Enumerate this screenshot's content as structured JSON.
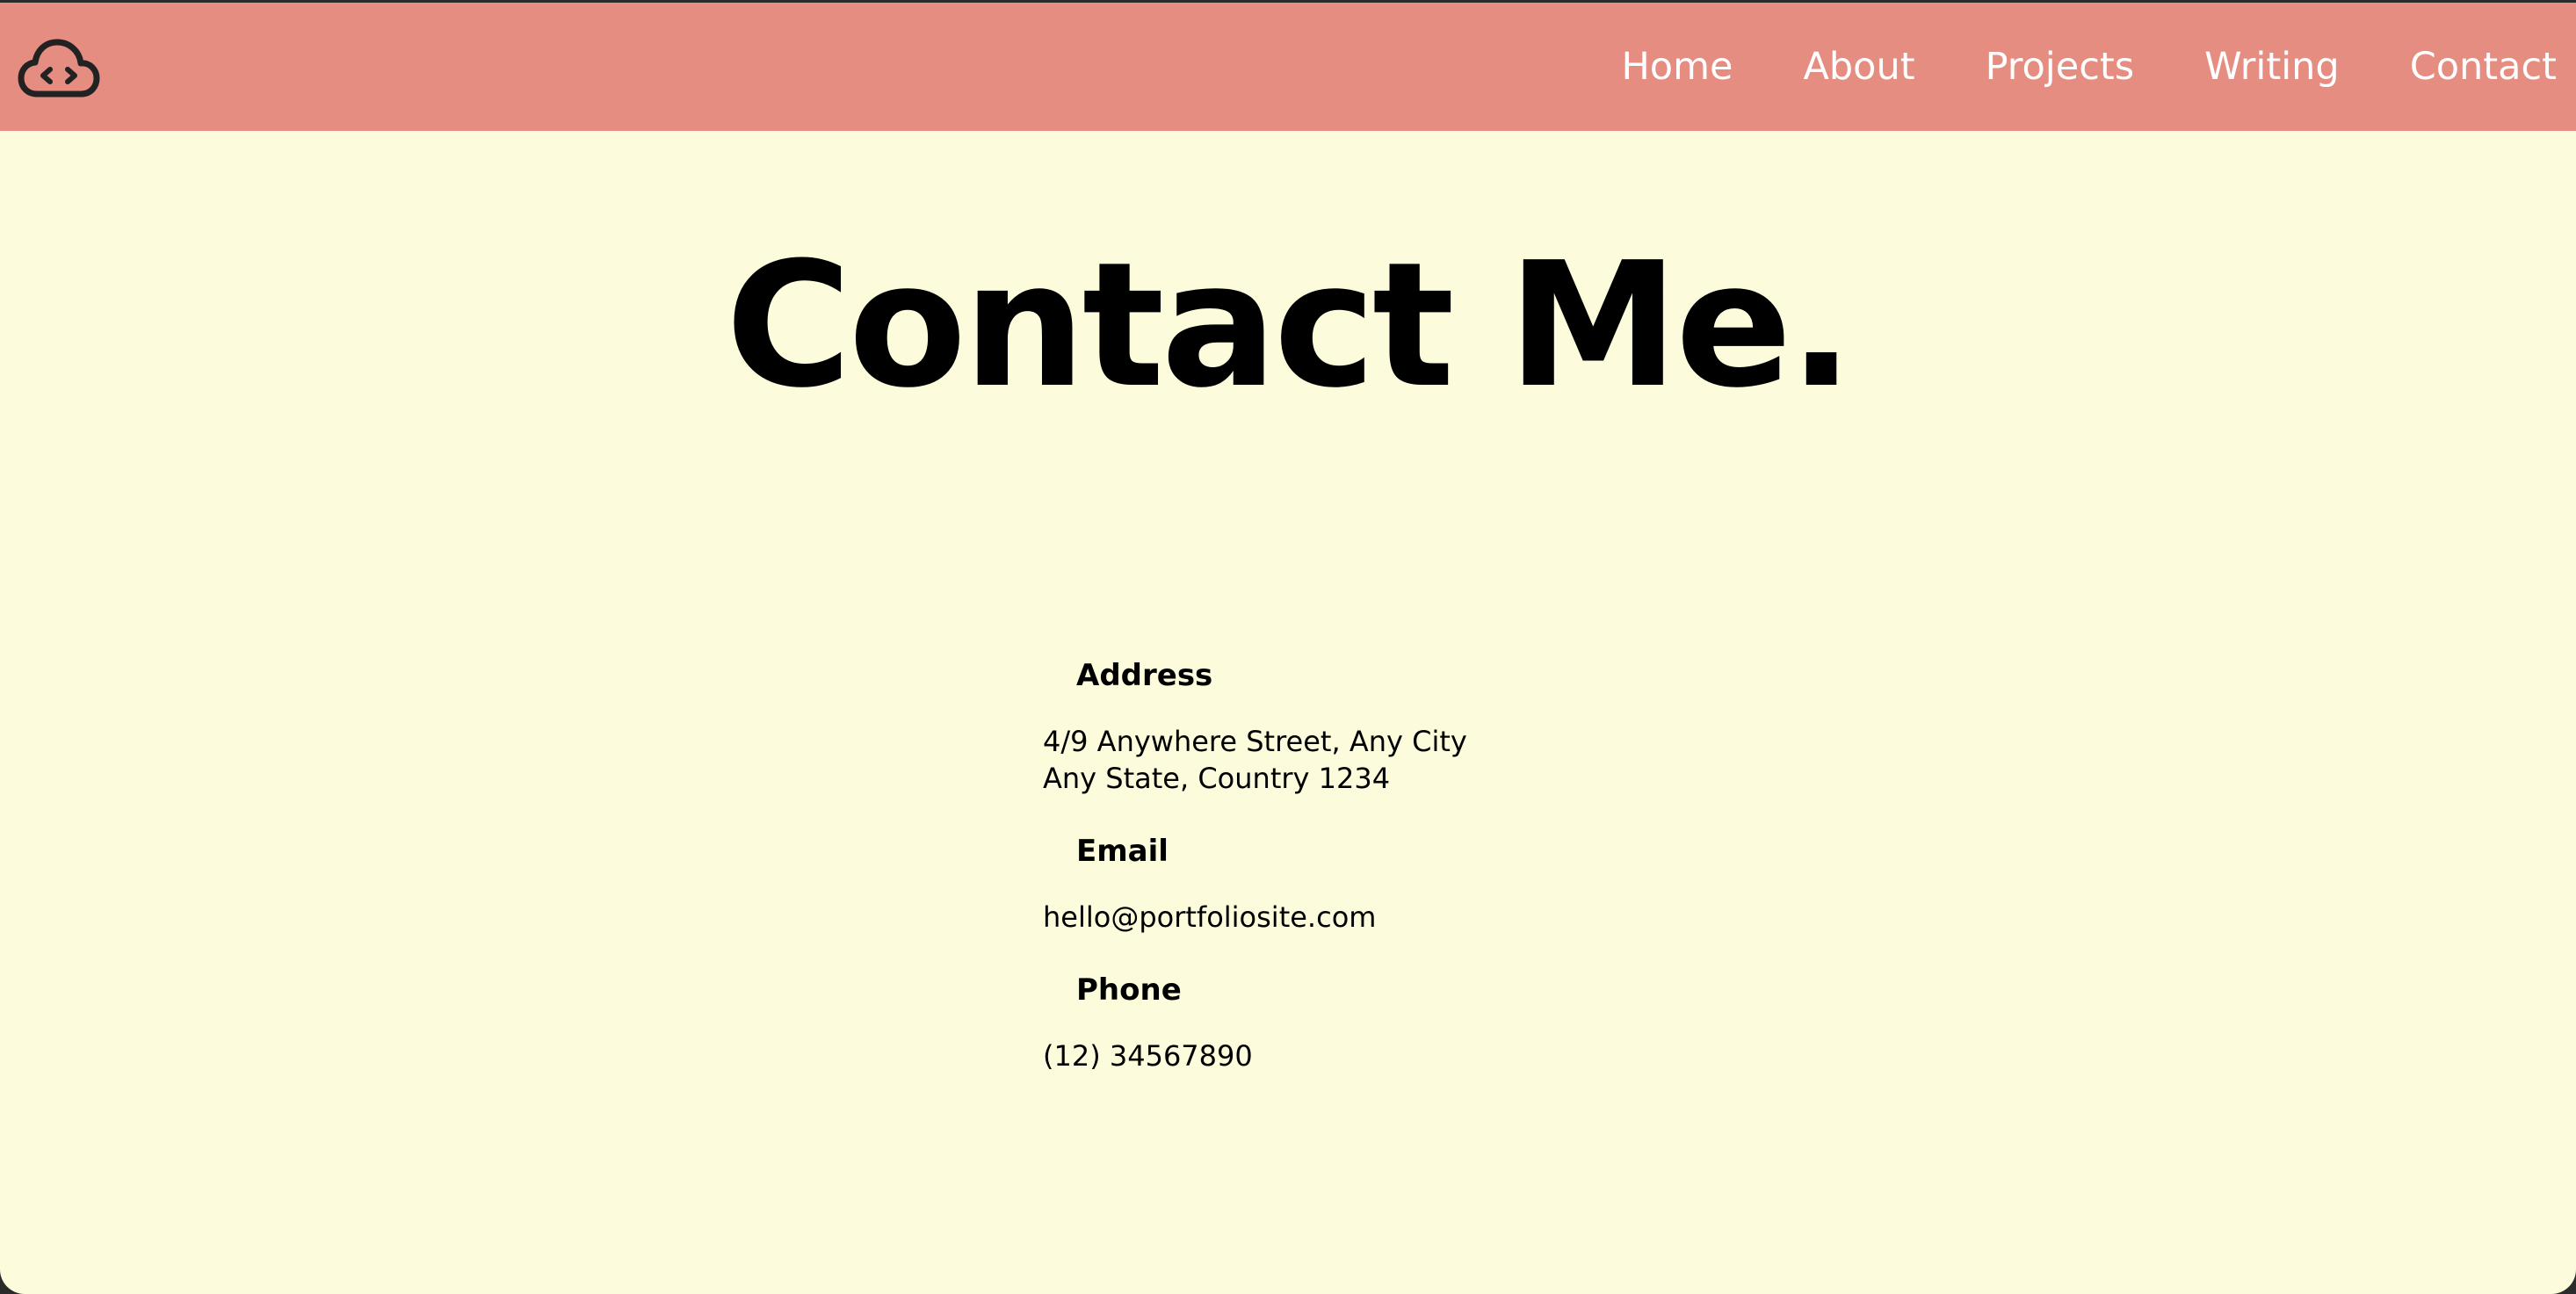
{
  "navbar": {
    "logo_icon": "cloud-code-icon",
    "background": "#e58d80",
    "links": [
      {
        "label": "Home"
      },
      {
        "label": "About"
      },
      {
        "label": "Projects"
      },
      {
        "label": "Writing"
      },
      {
        "label": "Contact"
      }
    ]
  },
  "page": {
    "background": "#fcfbdb",
    "title": "Contact Me."
  },
  "contact": {
    "address": {
      "heading": "Address",
      "line1": "4/9 Anywhere Street, Any City",
      "line2": "Any State, Country 1234"
    },
    "email": {
      "heading": "Email",
      "value": "hello@portfoliosite.com"
    },
    "phone": {
      "heading": "Phone",
      "value": "(12) 34567890"
    }
  }
}
